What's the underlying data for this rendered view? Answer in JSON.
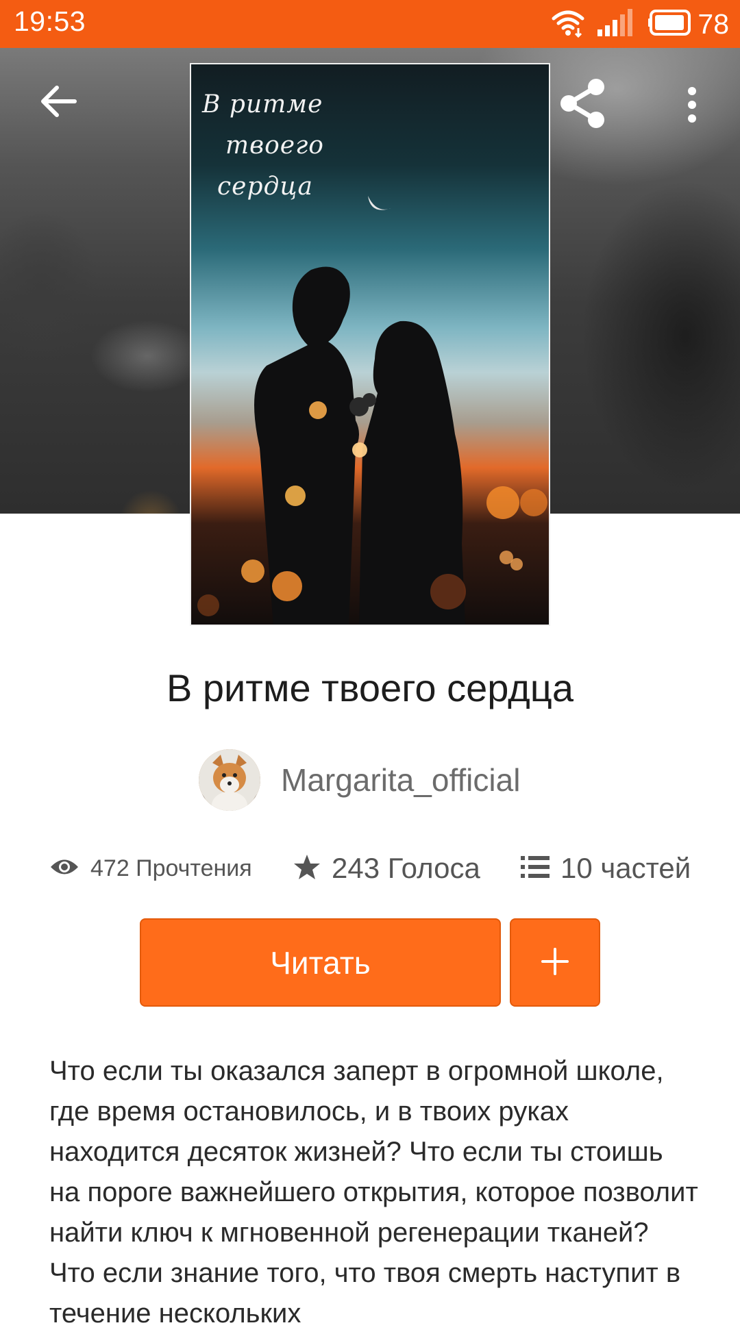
{
  "status_bar": {
    "time": "19:53",
    "battery": "78",
    "icons": [
      "wifi-icon",
      "signal-icon",
      "battery-icon"
    ]
  },
  "toolbar": {
    "icons": [
      "back-arrow-icon",
      "share-icon",
      "more-vert-icon"
    ]
  },
  "cover": {
    "title_lines": [
      "В ритме",
      "твоего",
      "сердца"
    ]
  },
  "book": {
    "title": "В ритме твоего сердца",
    "author": "Margarita_official",
    "stats": {
      "reads": "472 Прочтения",
      "votes": "243 Голоса",
      "parts": "10 частей"
    },
    "read_label": "Читать",
    "add_label": "+",
    "description": "Что если ты оказался заперт в огромной школе, где время остановилось, и в твоих руках находится десяток жизней? Что если ты стоишь на пороге важнейшего открытия, которое позволит найти ключ к мгновенной регенерации тканей? Что если знание того, что твоя смерть наступит в течение нескольких"
  },
  "colors": {
    "accent": "#ff6c1a",
    "status_bar": "#f45c12"
  }
}
